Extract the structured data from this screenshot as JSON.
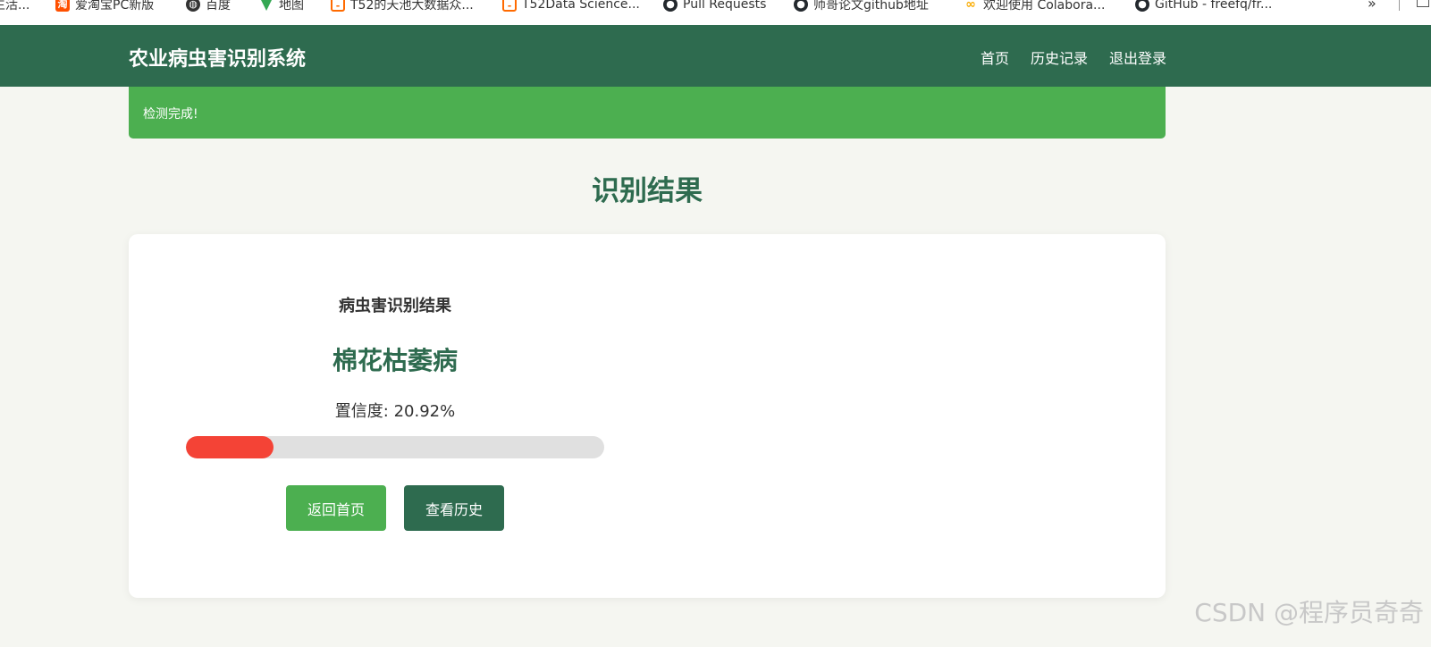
{
  "bookmarks": [
    {
      "label": "生活...",
      "icon": "bookmark-icon",
      "color": "#888888"
    },
    {
      "label": "爱淘宝PC新版",
      "icon": "taobao-icon",
      "color": "#ff5000"
    },
    {
      "label": "百度",
      "icon": "globe-icon",
      "color": "#333333"
    },
    {
      "label": "地图",
      "icon": "map-pin-icon",
      "color": "#34a853"
    },
    {
      "label": "T52的天池大数据众...",
      "icon": "tianchi-icon",
      "color": "#ff6a00"
    },
    {
      "label": "T52Data Science...",
      "icon": "tianchi-icon",
      "color": "#ff6a00"
    },
    {
      "label": "Pull Requests",
      "icon": "github-icon",
      "color": "#24292e"
    },
    {
      "label": "师哥论文github地址",
      "icon": "github-icon",
      "color": "#24292e"
    },
    {
      "label": "欢迎使用 Colabora...",
      "icon": "colab-icon",
      "color": "#f9ab00"
    },
    {
      "label": "GitHub - freefq/fr...",
      "icon": "github-icon",
      "color": "#24292e"
    }
  ],
  "bookmarks_more": "»",
  "navbar": {
    "brand": "农业病虫害识别系统",
    "links": [
      "首页",
      "历史记录",
      "退出登录"
    ],
    "color": "#2e6b4f"
  },
  "alert": {
    "text": "检测完成!",
    "color": "#4caf50"
  },
  "page_title": "识别结果",
  "result": {
    "heading": "病虫害识别结果",
    "name": "棉花枯萎病",
    "confidence_label": "置信度: 20.92%",
    "confidence": 0.2092,
    "bar_color": "#f44336"
  },
  "buttons": {
    "home": "返回首页",
    "history": "查看历史"
  },
  "watermark": "CSDN @程序员奇奇"
}
